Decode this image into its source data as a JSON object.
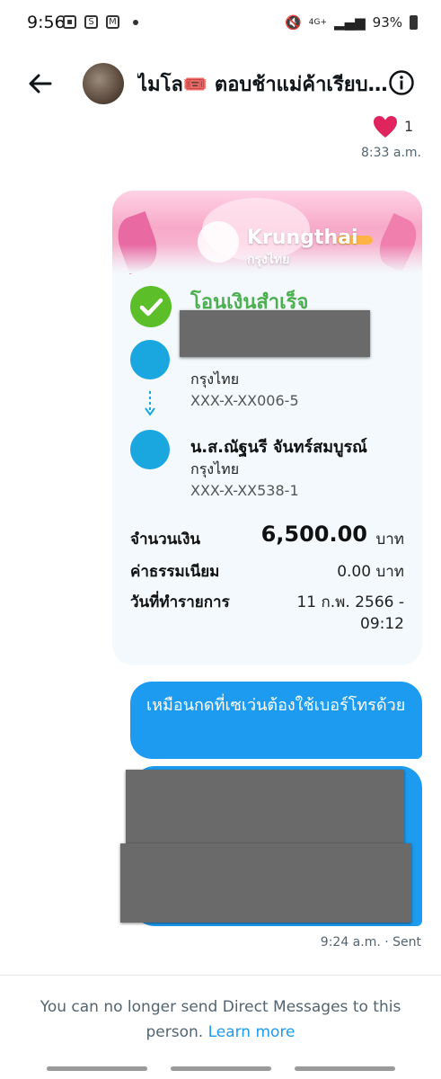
{
  "status_bar": {
    "time": "9:56",
    "network": "4G+",
    "battery": "93%"
  },
  "header": {
    "title": "ไมโล🎟️ ตอบช้าแม่ค้าเรียบร้อย"
  },
  "reaction": {
    "count": "1",
    "time": "8:33 a.m."
  },
  "receipt": {
    "brand": "Krungthai",
    "brand_thai": "กรุงไทย",
    "status": "โอนเงินสำเร็จ",
    "from_bank": "กรุงไทย",
    "from_account": "XXX-X-XX006-5",
    "to_name": "น.ส.ณัฐนรี จันทร์สมบูรณ์",
    "to_bank": "กรุงไทย",
    "to_account": "XXX-X-XX538-1",
    "amount_label": "จำนวนเงิน",
    "amount": "6,500.00",
    "currency": "บาท",
    "fee_label": "ค่าธรรมเนียม",
    "fee": "0.00 บาท",
    "date_label": "วันที่ทำรายการ",
    "date": "11 ก.พ. 2566 -",
    "time": "09:12"
  },
  "messages": {
    "sent_text": "เหมือนกดที่เซเว่นต้องใช้เบอร์โทรด้วย",
    "sent_time": "9:24 a.m. · Sent"
  },
  "footer": {
    "notice": "You can no longer send Direct Messages to this person.",
    "learn_more": "Learn more"
  }
}
